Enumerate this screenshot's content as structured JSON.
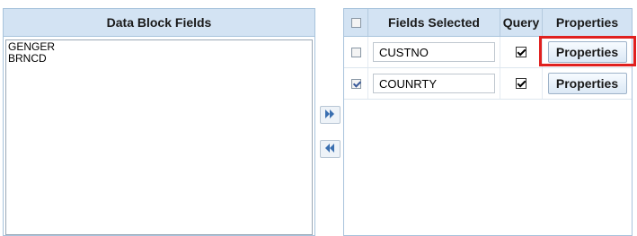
{
  "left_panel": {
    "title": "Data Block Fields",
    "items": [
      "GENGER",
      "BRNCD"
    ]
  },
  "move_buttons": {
    "add_icon": "double-right-arrow-icon",
    "remove_icon": "double-left-arrow-icon"
  },
  "right_panel": {
    "headers": {
      "fields_selected": "Fields Selected",
      "query": "Query",
      "properties": "Properties"
    },
    "rows": [
      {
        "selected": false,
        "field": "CUSTNO",
        "query": true,
        "button_label": "Properties"
      },
      {
        "selected": true,
        "field": "COUNRTY",
        "query": true,
        "button_label": "Properties"
      }
    ]
  },
  "colors": {
    "header_bg": "#d3e3f3",
    "highlight": "#e0201e"
  }
}
